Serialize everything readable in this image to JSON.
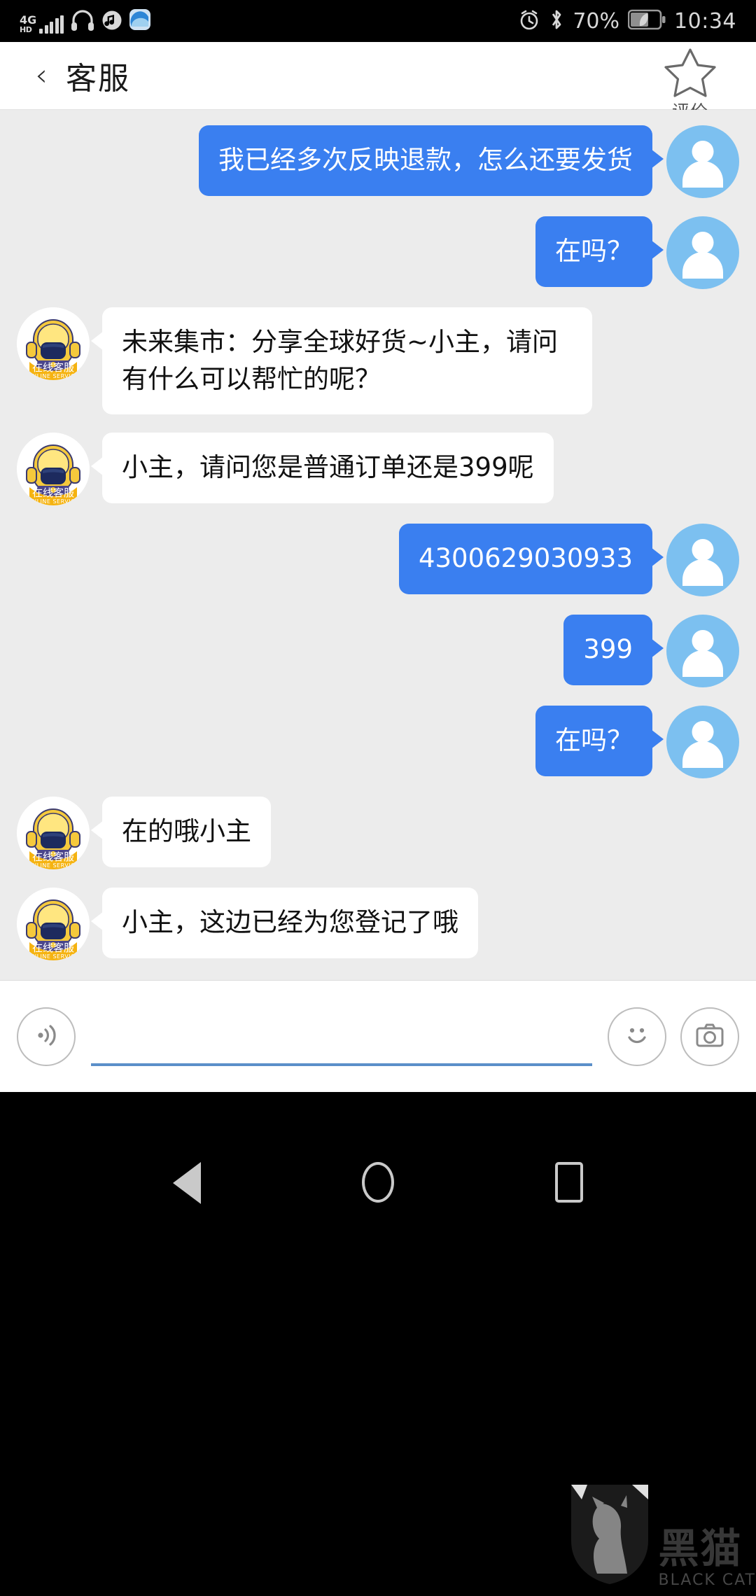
{
  "statusbar": {
    "network_type": "4G",
    "network_sub": "HD",
    "battery_percent": "70%",
    "time": "10:34",
    "icons": [
      "signal-bars-icon",
      "headphones-icon",
      "music-note-icon",
      "app-icon",
      "alarm-icon",
      "bluetooth-icon",
      "battery-icon"
    ]
  },
  "header": {
    "back_label": "‹",
    "title": "客服",
    "rate_label": "评价"
  },
  "chat": {
    "agent_badge_cn": "在线客服",
    "agent_badge_en": "ONLINE SERVICE",
    "messages": [
      {
        "side": "out",
        "text": "我已经多次反映退款，怎么还要发货"
      },
      {
        "side": "out",
        "text": "在吗？"
      },
      {
        "side": "in",
        "text": "未来集市：分享全球好货~小主，请问有什么可以帮忙的呢？"
      },
      {
        "side": "in",
        "text": "小主，请问您是普通订单还是399呢"
      },
      {
        "side": "out",
        "text": "4300629030933"
      },
      {
        "side": "out",
        "text": "399"
      },
      {
        "side": "out",
        "text": "在吗？"
      },
      {
        "side": "in",
        "text": "在的哦小主"
      },
      {
        "side": "in",
        "text": "小主，这边已经为您登记了哦"
      }
    ]
  },
  "inputbar": {
    "voice_icon": "voice-wave-icon",
    "input_value": "",
    "input_placeholder": "",
    "emoji_icon": "smiley-icon",
    "camera_icon": "camera-icon"
  },
  "navbar": {
    "back_icon": "nav-back-triangle-icon",
    "home_icon": "nav-home-circle-icon",
    "recents_icon": "nav-recents-square-icon"
  },
  "watermark": {
    "cn": "黑猫",
    "en": "BLACK CAT"
  },
  "colors": {
    "outgoing_bubble": "#3a7ff0",
    "incoming_bubble": "#ffffff",
    "chat_background": "#ececec",
    "user_avatar": "#7cc0f0",
    "input_underline": "#5b8fc9",
    "badge_yellow": "#f5c022"
  }
}
